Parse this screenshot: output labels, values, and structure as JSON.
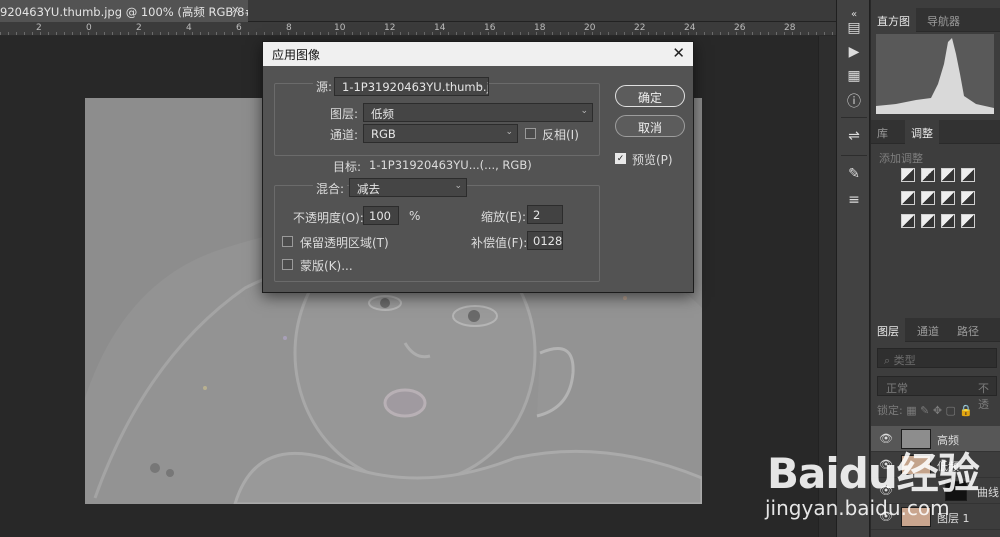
{
  "document": {
    "tab_title": "920463YU.thumb.jpg @ 100% (高频  RGB/8#) *",
    "tab_close": "×"
  },
  "ruler": {
    "ticks": [
      "2",
      "0",
      "2",
      "4",
      "6",
      "8",
      "10",
      "12",
      "14",
      "16",
      "18",
      "20",
      "22",
      "24",
      "26",
      "28"
    ]
  },
  "dialog": {
    "title": "应用图像",
    "close": "✕",
    "source": {
      "label": "源:",
      "value": "1-1P31920463YU.thumb.j..."
    },
    "layer": {
      "label": "图层:",
      "value": "低频"
    },
    "channel": {
      "label": "通道:",
      "value": "RGB"
    },
    "invert": {
      "label": "反相(I)",
      "checked": false
    },
    "target": {
      "label": "目标:",
      "value": "1-1P31920463YU...(..., RGB)"
    },
    "blending": {
      "label": "混合:",
      "value": "减去"
    },
    "opacity": {
      "label": "不透明度(O):",
      "value": "100",
      "unit": "%"
    },
    "scale": {
      "label": "缩放(E):",
      "value": "2"
    },
    "offset": {
      "label": "补偿值(F):",
      "value": "0128"
    },
    "preserve_transparency": {
      "label": "保留透明区域(T)",
      "checked": false
    },
    "mask": {
      "label": "蒙版(K)...",
      "checked": false
    },
    "buttons": {
      "ok": "确定",
      "cancel": "取消"
    },
    "preview": {
      "label": "预览(P)",
      "checked": true
    }
  },
  "panels": {
    "top_tabs": [
      "直方图",
      "导航器"
    ],
    "adjust_tabs": [
      "库",
      "调整"
    ],
    "adjust_hint": "添加调整",
    "layer_tabs": [
      "图层",
      "通道",
      "路径"
    ],
    "search_placeholder": "类型",
    "blend_mode": "正常",
    "opacity_short": "不透",
    "lock_label": "锁定:",
    "layers": [
      {
        "name": "高频",
        "active": true
      },
      {
        "name": "低频",
        "active": false
      },
      {
        "name": "曲线",
        "active": false
      },
      {
        "name": "图层 1",
        "active": false
      }
    ]
  },
  "watermark": {
    "brand": "Baidu经验",
    "url": "jingyan.baidu.com"
  }
}
